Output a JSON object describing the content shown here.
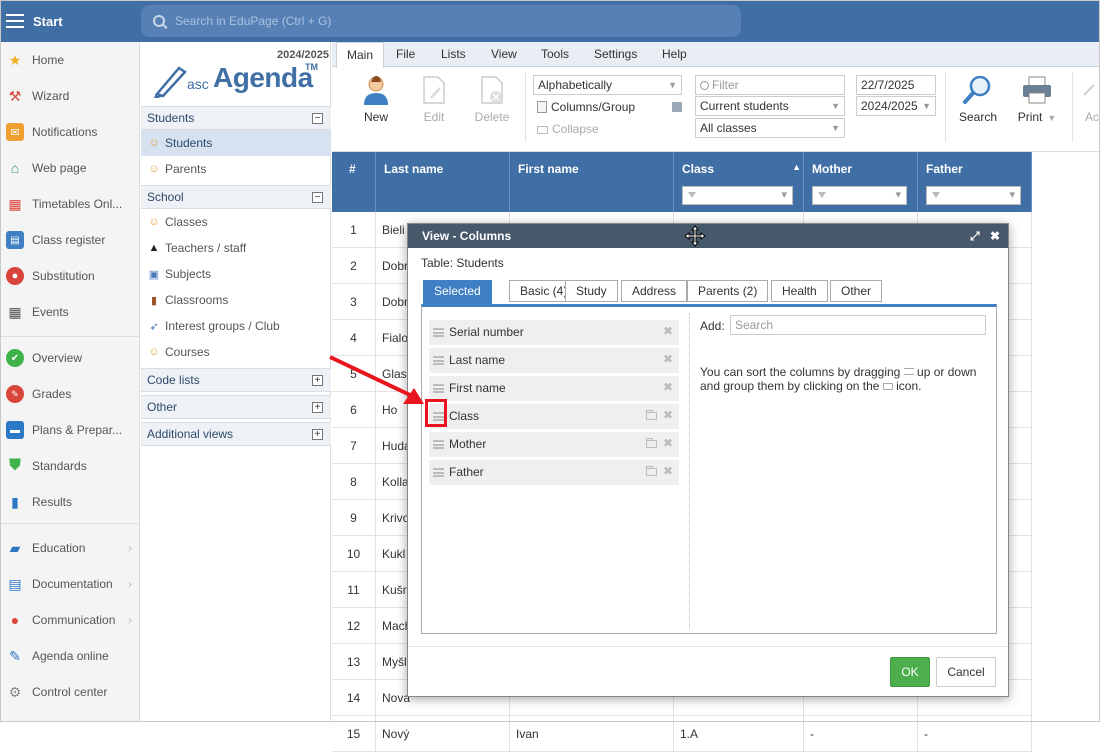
{
  "topbar": {
    "start_label": "Start",
    "search_placeholder": "Search in EduPage (Ctrl + G)"
  },
  "leftnav": [
    {
      "label": "Home",
      "icon": "star-icon"
    },
    {
      "label": "Wizard",
      "icon": "wand-icon"
    },
    {
      "label": "Notifications",
      "icon": "envelope-icon"
    },
    {
      "label": "Web page",
      "icon": "house-icon"
    },
    {
      "label": "Timetables Onl...",
      "icon": "calendar-icon"
    },
    {
      "label": "Class register",
      "icon": "register-icon"
    },
    {
      "label": "Substitution",
      "icon": "person-icon"
    },
    {
      "label": "Events",
      "icon": "events-icon"
    },
    {
      "label": "Overview",
      "icon": "check-circle-icon"
    },
    {
      "label": "Grades",
      "icon": "grades-icon"
    },
    {
      "label": "Plans & Prepar...",
      "icon": "briefcase-icon"
    },
    {
      "label": "Standards",
      "icon": "shield-icon"
    },
    {
      "label": "Results",
      "icon": "bar-chart-icon"
    },
    {
      "label": "Education",
      "icon": "book-icon"
    },
    {
      "label": "Documentation",
      "icon": "document-icon"
    },
    {
      "label": "Communication",
      "icon": "chat-icon"
    },
    {
      "label": "Agenda online",
      "icon": "pen-icon"
    },
    {
      "label": "Control center",
      "icon": "gear-icon"
    }
  ],
  "sidepanel": {
    "year": "2024/2025",
    "logo_asc": "asc",
    "logo_agenda": "Agenda",
    "logo_tm": "TM",
    "students_section": "Students",
    "students_items": [
      "Students",
      "Parents"
    ],
    "school_section": "School",
    "school_items": [
      "Classes",
      "Teachers / staff",
      "Subjects",
      "Classrooms",
      "Interest groups / Club",
      "Courses"
    ],
    "code_lists": "Code lists",
    "other": "Other",
    "additional_views": "Additional views",
    "collapse_symbol": "−",
    "expand_symbol": "+"
  },
  "ribbon": {
    "tabs": [
      "Main",
      "File",
      "Lists",
      "View",
      "Tools",
      "Settings",
      "Help"
    ],
    "new": "New",
    "edit": "Edit",
    "delete": "Delete",
    "sort_select": "Alphabetically",
    "columns_group": "Columns/Group",
    "collapse": "Collapse",
    "filter_placeholder": "Filter",
    "current_students": "Current students",
    "all_classes": "All classes",
    "date": "22/7/2025",
    "year_select": "2024/2025",
    "search": "Search",
    "print": "Print",
    "cut_label": "Ac"
  },
  "grid": {
    "headers": [
      "#",
      "Last name",
      "First name",
      "Class",
      "Mother",
      "Father"
    ],
    "sort_indicator": "▲",
    "rows": [
      {
        "n": "1",
        "last": "Bieli",
        "first": "",
        "class": "",
        "mother": "",
        "father": ""
      },
      {
        "n": "2",
        "last": "Dobr",
        "first": "",
        "class": "",
        "mother": "",
        "father": ""
      },
      {
        "n": "3",
        "last": "Dobr",
        "first": "",
        "class": "",
        "mother": "",
        "father": ""
      },
      {
        "n": "4",
        "last": "Fialo",
        "first": "",
        "class": "",
        "mother": "",
        "father": ""
      },
      {
        "n": "5",
        "last": "Glas",
        "first": "",
        "class": "",
        "mother": "",
        "father": ""
      },
      {
        "n": "6",
        "last": "Ho",
        "first": "",
        "class": "",
        "mother": "",
        "father": ""
      },
      {
        "n": "7",
        "last": "Huda",
        "first": "",
        "class": "",
        "mother": "",
        "father": ""
      },
      {
        "n": "8",
        "last": "Kolla",
        "first": "",
        "class": "",
        "mother": "",
        "father": ""
      },
      {
        "n": "9",
        "last": "Krivo",
        "first": "",
        "class": "",
        "mother": "",
        "father": ""
      },
      {
        "n": "10",
        "last": "Kukl",
        "first": "",
        "class": "",
        "mother": "",
        "father": ""
      },
      {
        "n": "11",
        "last": "Kušr",
        "first": "",
        "class": "",
        "mother": "",
        "father": ""
      },
      {
        "n": "12",
        "last": "Mach",
        "first": "",
        "class": "",
        "mother": "",
        "father": ""
      },
      {
        "n": "13",
        "last": "Myšl",
        "first": "",
        "class": "",
        "mother": "",
        "father": ""
      },
      {
        "n": "14",
        "last": "Nova",
        "first": "",
        "class": "",
        "mother": "",
        "father": ""
      },
      {
        "n": "15",
        "last": "Nový",
        "first": "Ivan",
        "class": "1.A",
        "mother": "-",
        "father": "-"
      }
    ]
  },
  "dialog": {
    "title": "View - Columns",
    "table_label": "Table: Students",
    "tabs": [
      "Selected",
      "Basic (4)",
      "Study",
      "Address",
      "Parents (2)",
      "Health",
      "Other"
    ],
    "columns": [
      "Serial number",
      "Last name",
      "First name",
      "Class",
      "Mother",
      "Father"
    ],
    "add_label": "Add:",
    "search_placeholder": "Search",
    "help_line1": "You can sort the columns by dragging",
    "help_line1_end": "up or down",
    "help_line2": "and group them by clicking on the",
    "help_line2_end": "icon.",
    "ok": "OK",
    "cancel": "Cancel",
    "maximize_symbol": "⤢",
    "close_symbol": "✖",
    "remove_symbol": "✖"
  },
  "colors": {
    "topbar": "#3f6fa5",
    "dialog_title": "#47586b",
    "tab_active": "#3f7fc4",
    "ok_button": "#4cae4c",
    "annotation": "#e8161c"
  }
}
